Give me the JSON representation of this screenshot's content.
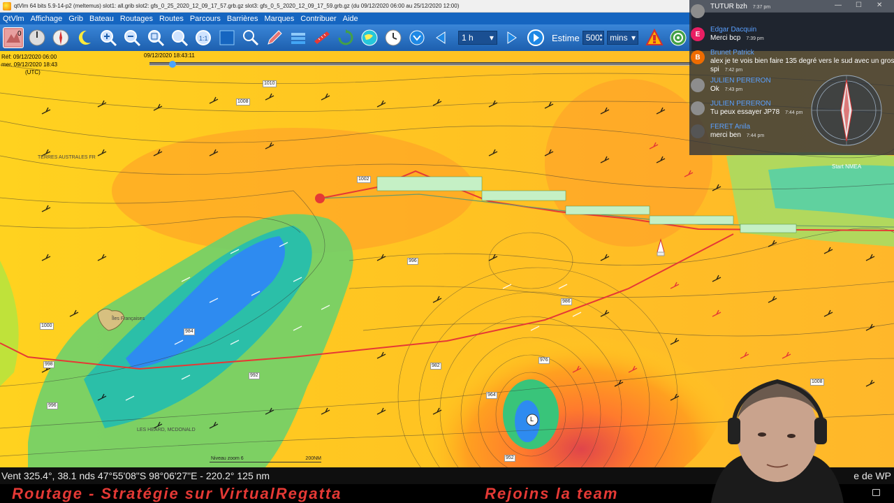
{
  "window": {
    "title": "qtVlm 64 bits 5.9-14-p2 (meltemus) slot1: all.grib slot2: gfs_0_25_2020_12_09_17_57.grb.gz slot3: gfs_0_5_2020_12_09_17_59.grb.gz (du 09/12/2020 06:00 au 25/12/2020 12:00)"
  },
  "menu": {
    "items": [
      "QtVlm",
      "Affichage",
      "Grib",
      "Bateau",
      "Routages",
      "Routes",
      "Parcours",
      "Barrières",
      "Marques",
      "Contribuer",
      "Aide"
    ]
  },
  "toolbar": {
    "step_value": "1 h",
    "estime_label": "Estime",
    "estime_value": "500",
    "unit_value": "mins"
  },
  "map": {
    "ref_line1": "Réf: 09/12/2020 06:00",
    "ref_line2": "mer. 09/12/2020 18:43",
    "ref_line3": "(UTC)",
    "timeline_date": "09/12/2020 18:43:11",
    "label_terres": "TERRES AUSTRALES FR",
    "label_heard": "LES HEARD, MCDONALD",
    "label_iles": "Îles Françaises",
    "low_symbol": "L",
    "start_label": "Start NMEA",
    "scale_zoom": "Niveau zoom 6",
    "scale_dist": "200NM",
    "isobars": [
      "1010",
      "1008",
      "1002",
      "996",
      "1000",
      "984",
      "998",
      "996",
      "992",
      "986",
      "982",
      "976",
      "964",
      "952",
      "1008"
    ]
  },
  "status": {
    "text": "Vent 325.4°, 38.1 nds 47°55'08\"S 98°06'27\"E - 220.2° 125 nm",
    "right_text": "e de WP"
  },
  "banner": {
    "left": "Routage - Stratégie  sur VirtualRegatta",
    "right": "Rejoins la team"
  },
  "chat": {
    "messages": [
      {
        "name": "",
        "text": "TUTUR bzh",
        "time": "7:37 pm",
        "avatar": "",
        "color": "#8d8d8d"
      },
      {
        "name": "Edgar Dacquin",
        "text": "Merci bcp",
        "time": "7:39 pm",
        "avatar": "E",
        "color": "#e91e63"
      },
      {
        "name": "Brunet Patrick",
        "text": "alex je te vois bien faire 135 degré vers le sud avec un gros spi",
        "time": "7:42 pm",
        "avatar": "B",
        "color": "#ef6c00"
      },
      {
        "name": "JULIEN PERERON",
        "text": "Ok",
        "time": "7:43 pm",
        "avatar": "",
        "color": "#8d8d8d"
      },
      {
        "name": "JULIEN PERERON",
        "text": "Tu peux essayer JP78",
        "time": "7:44 pm",
        "avatar": "",
        "color": "#8d8d8d"
      },
      {
        "name": "FERET Anila",
        "text": "merci ben",
        "time": "7:44 pm",
        "avatar": "",
        "color": "#555"
      }
    ]
  }
}
